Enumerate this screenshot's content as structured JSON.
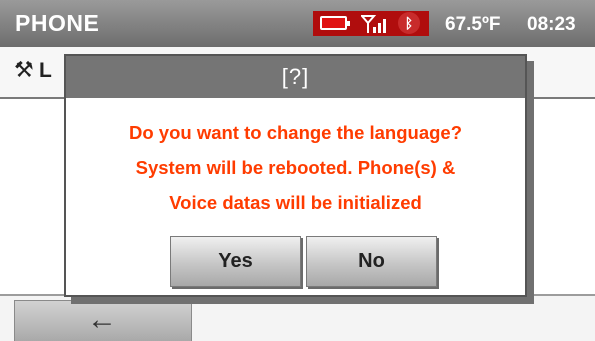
{
  "topbar": {
    "title": "PHONE",
    "temperature": "67.5ºF",
    "time": "08:23",
    "icons": [
      "battery-icon",
      "signal-icon",
      "bluetooth-icon"
    ],
    "status_bg_color": "#b00d0d"
  },
  "subheader": {
    "icon": "settings-icon",
    "label": "L"
  },
  "dialog": {
    "title": "[?]",
    "message_lines": [
      "Do you want to change the language?",
      "System will be rebooted. Phone(s) &",
      "Voice datas will be initialized"
    ],
    "message_color": "#ff3c00",
    "yes_label": "Yes",
    "no_label": "No"
  },
  "bottombar": {
    "back_icon": "back-arrow-icon"
  }
}
